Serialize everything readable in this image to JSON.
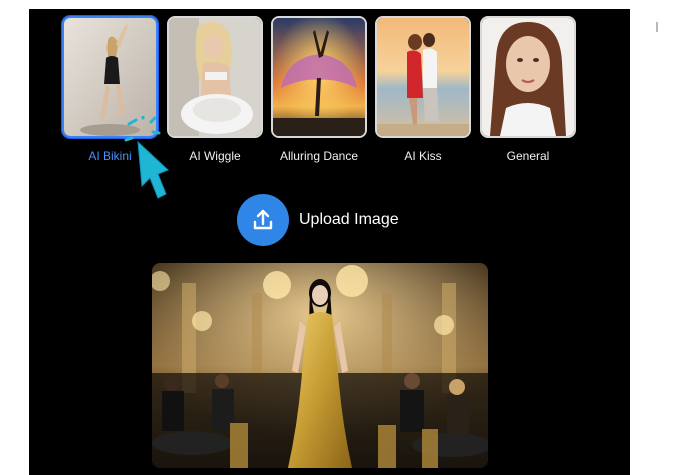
{
  "templates": [
    {
      "label": "AI Bikini",
      "selected": true
    },
    {
      "label": "AI Wiggle",
      "selected": false
    },
    {
      "label": "Alluring Dance",
      "selected": false
    },
    {
      "label": "AI Kiss",
      "selected": false
    },
    {
      "label": "General",
      "selected": false
    }
  ],
  "upload": {
    "label": "Upload Image",
    "icon": "upload-icon"
  },
  "colors": {
    "accent": "#2f86e6",
    "selected_label": "#4a90ff",
    "background": "#000000",
    "cursor": "#1fb6d6"
  }
}
